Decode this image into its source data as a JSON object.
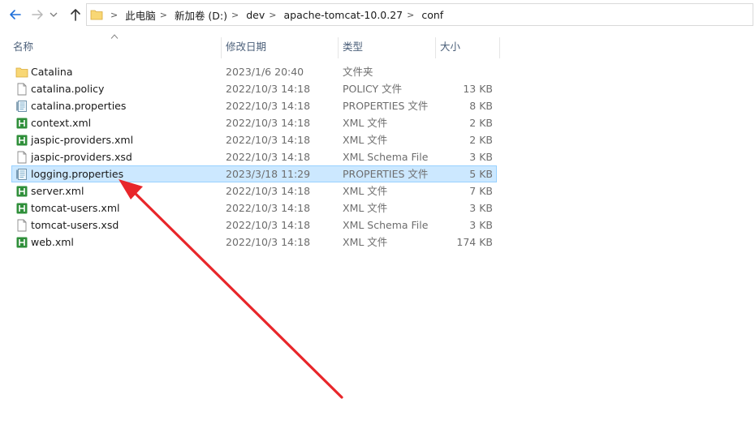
{
  "breadcrumbs": [
    "此电脑",
    "新加卷 (D:)",
    "dev",
    "apache-tomcat-10.0.27",
    "conf"
  ],
  "columns": {
    "name": "名称",
    "date": "修改日期",
    "type": "类型",
    "size": "大小"
  },
  "files": [
    {
      "name": "Catalina",
      "date": "2023/1/6 20:40",
      "type": "文件夹",
      "size": "",
      "icon": "folder-icon"
    },
    {
      "name": "catalina.policy",
      "date": "2022/10/3 14:18",
      "type": "POLICY 文件",
      "size": "13 KB",
      "icon": "file-icon"
    },
    {
      "name": "catalina.properties",
      "date": "2022/10/3 14:18",
      "type": "PROPERTIES 文件",
      "size": "8 KB",
      "icon": "properties-file-icon"
    },
    {
      "name": "context.xml",
      "date": "2022/10/3 14:18",
      "type": "XML 文件",
      "size": "2 KB",
      "icon": "xml-file-icon"
    },
    {
      "name": "jaspic-providers.xml",
      "date": "2022/10/3 14:18",
      "type": "XML 文件",
      "size": "2 KB",
      "icon": "xml-file-icon"
    },
    {
      "name": "jaspic-providers.xsd",
      "date": "2022/10/3 14:18",
      "type": "XML Schema File",
      "size": "3 KB",
      "icon": "file-icon"
    },
    {
      "name": "logging.properties",
      "date": "2023/3/18 11:29",
      "type": "PROPERTIES 文件",
      "size": "5 KB",
      "icon": "properties-file-icon",
      "selected": true
    },
    {
      "name": "server.xml",
      "date": "2022/10/3 14:18",
      "type": "XML 文件",
      "size": "7 KB",
      "icon": "xml-file-icon"
    },
    {
      "name": "tomcat-users.xml",
      "date": "2022/10/3 14:18",
      "type": "XML 文件",
      "size": "3 KB",
      "icon": "xml-file-icon"
    },
    {
      "name": "tomcat-users.xsd",
      "date": "2022/10/3 14:18",
      "type": "XML Schema File",
      "size": "3 KB",
      "icon": "file-icon"
    },
    {
      "name": "web.xml",
      "date": "2022/10/3 14:18",
      "type": "XML 文件",
      "size": "174 KB",
      "icon": "xml-file-icon"
    }
  ],
  "colors": {
    "selection_bg": "#cce8ff",
    "selection_border": "#99d1ff",
    "nav_blue": "#1e6fd9",
    "annotation_red": "#e8262a",
    "xml_icon_green": "#2f8f3a",
    "folder_yellow": "#f8d775"
  }
}
